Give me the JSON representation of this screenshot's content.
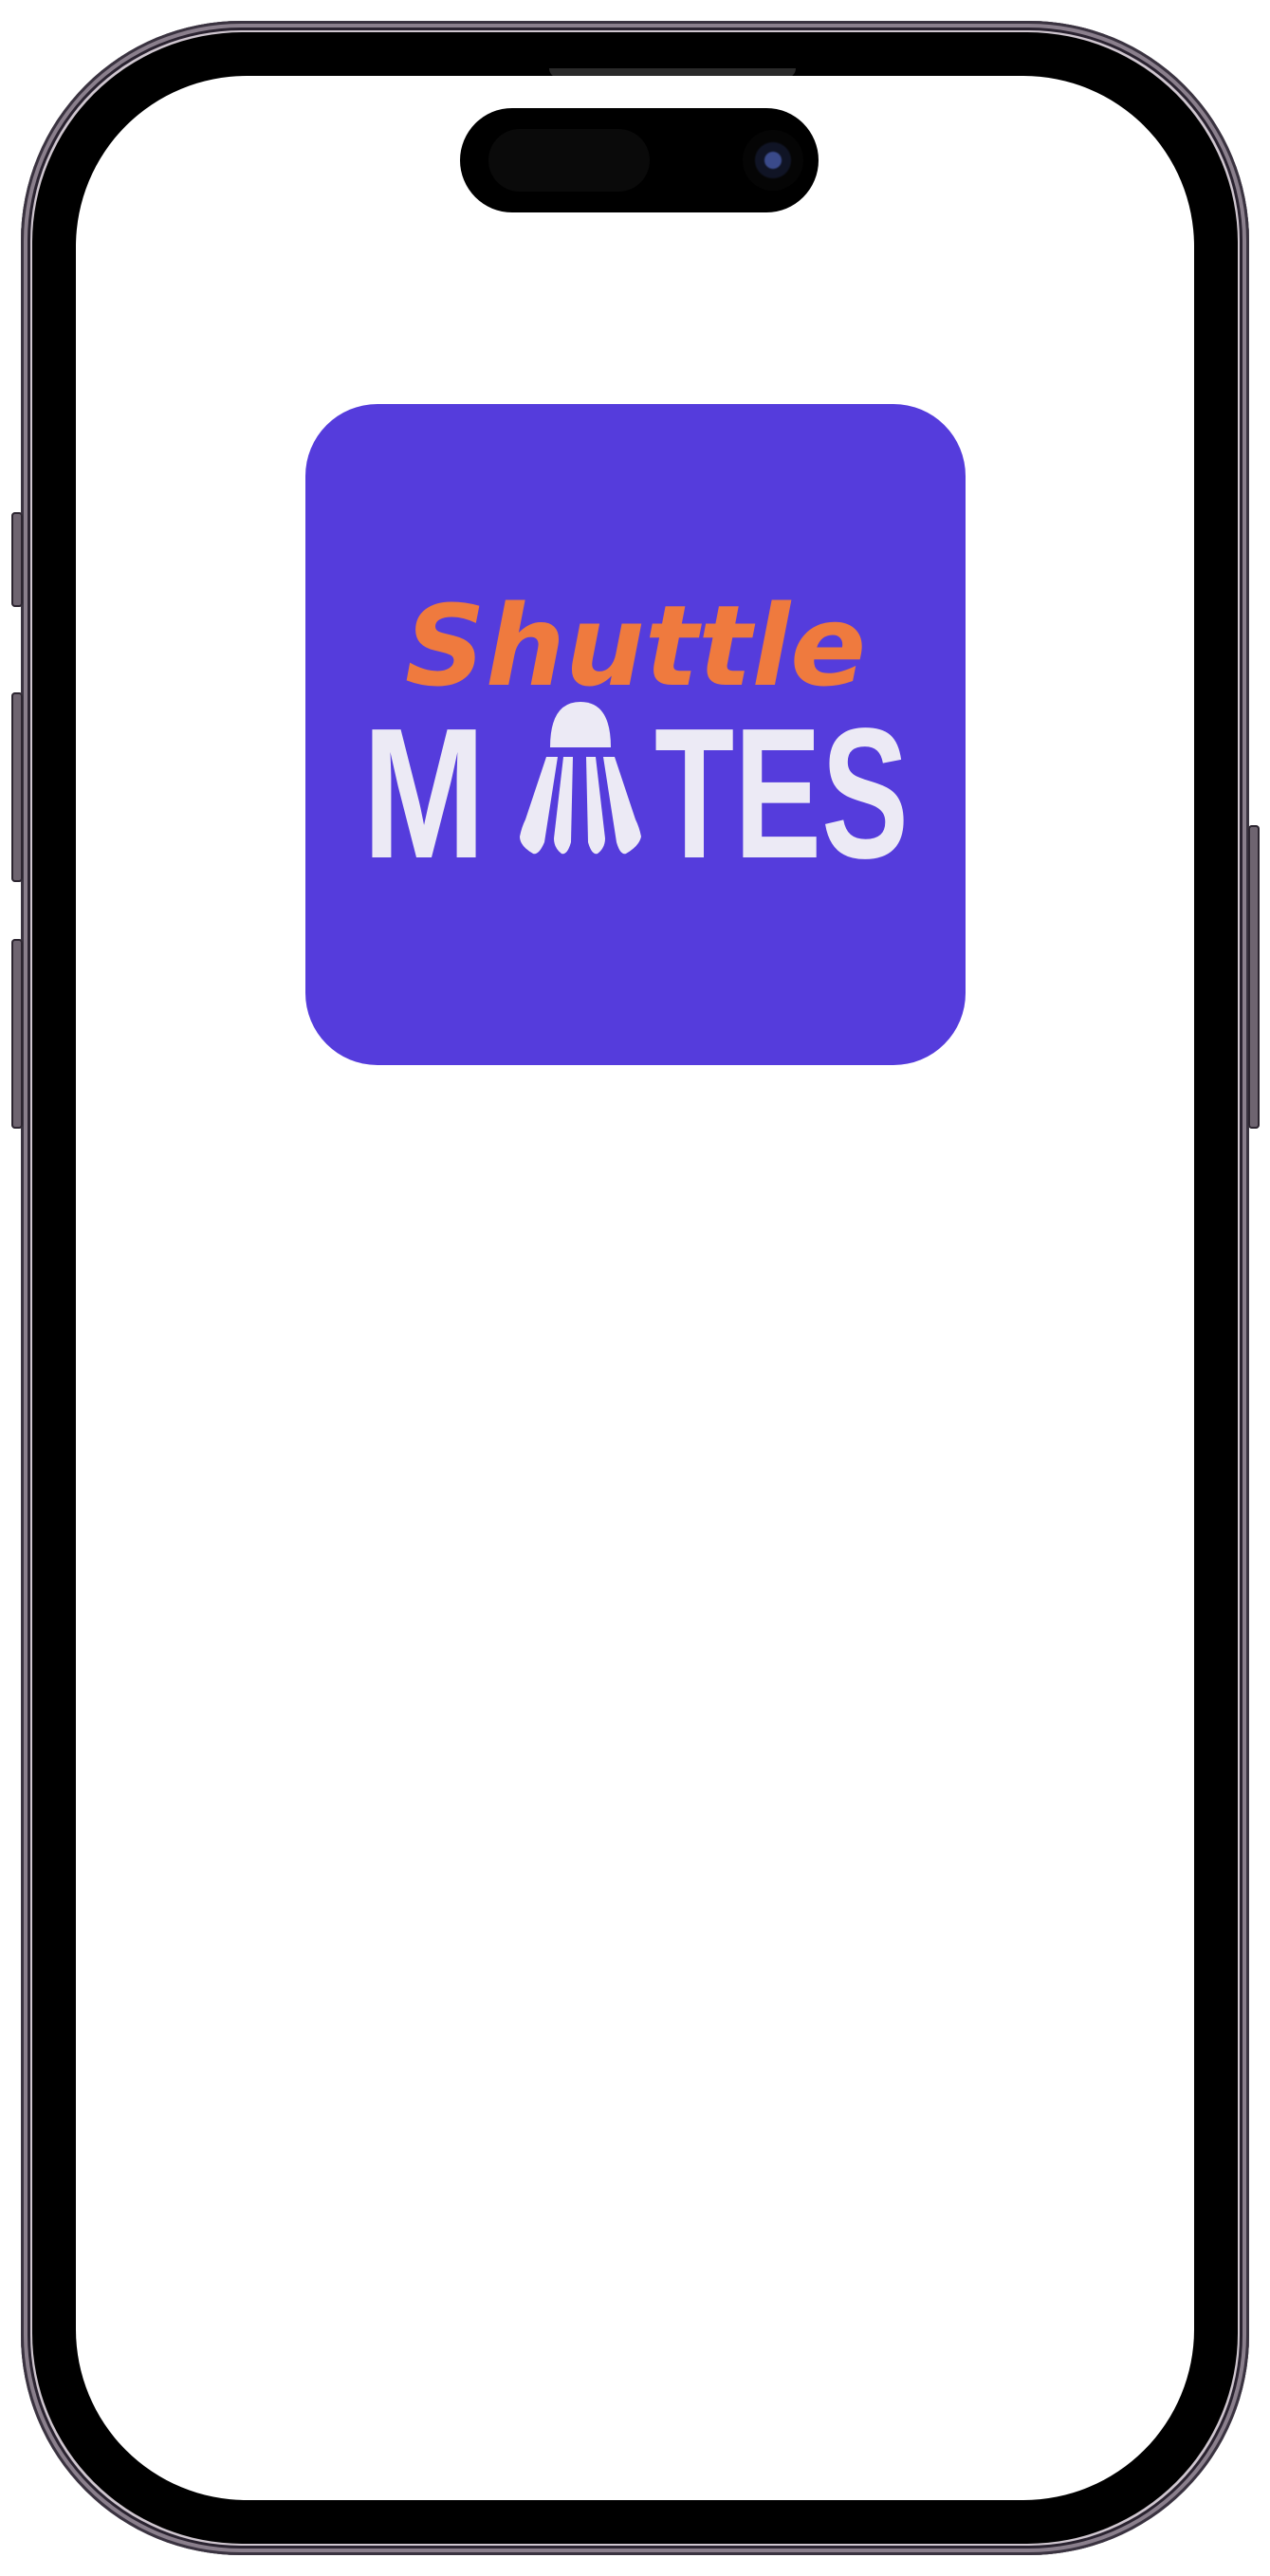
{
  "app": {
    "logo_line1": "Shuttle",
    "logo_line2": "MATES"
  },
  "colors": {
    "tile": "#553cdc",
    "accent_orange": "#ef7a3e",
    "logo_white": "#eceaf5",
    "screen_bg": "#ffffff"
  },
  "icons": {
    "shuttlecock": "shuttlecock-icon"
  }
}
